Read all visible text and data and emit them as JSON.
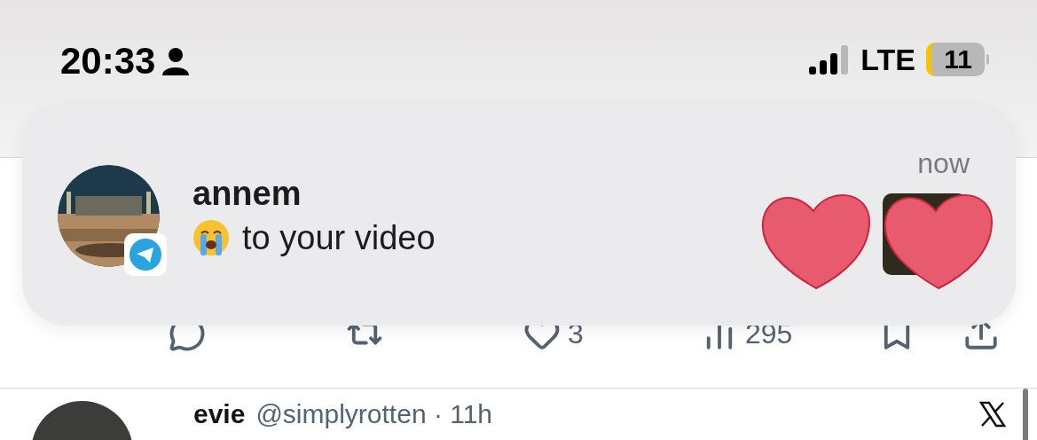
{
  "status_bar": {
    "time": "20:33",
    "network": "LTE",
    "battery": "11"
  },
  "notification": {
    "sender": "annem",
    "message": "to your video",
    "time": "now"
  },
  "tweet_actions": [
    {
      "kind": "reply"
    },
    {
      "kind": "retweet"
    },
    {
      "kind": "like",
      "count": "3"
    },
    {
      "kind": "views",
      "count": "295"
    },
    {
      "kind": "bookmark"
    },
    {
      "kind": "share"
    }
  ],
  "next_tweet": {
    "name": "evie",
    "handle": "@simplyrotten · 11h"
  }
}
